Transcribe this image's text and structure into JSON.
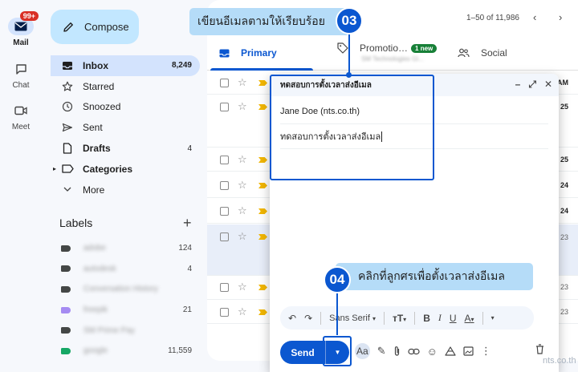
{
  "rail": {
    "mail_label": "Mail",
    "mail_badge": "99+",
    "chat_label": "Chat",
    "meet_label": "Meet"
  },
  "sidebar": {
    "compose_label": "Compose",
    "items": [
      {
        "label": "Inbox",
        "count": "8,249"
      },
      {
        "label": "Starred",
        "count": ""
      },
      {
        "label": "Snoozed",
        "count": ""
      },
      {
        "label": "Sent",
        "count": ""
      },
      {
        "label": "Drafts",
        "count": "4"
      },
      {
        "label": "Categories",
        "count": ""
      },
      {
        "label": "More",
        "count": ""
      }
    ],
    "labels_heading": "Labels",
    "labels": [
      {
        "name": "adobe",
        "count": "124",
        "color": "#444746"
      },
      {
        "name": "autodesk",
        "count": "4",
        "color": "#444746"
      },
      {
        "name": "Conversation History",
        "count": "",
        "color": "#444746"
      },
      {
        "name": "freepik",
        "count": "21",
        "color": "#a58bf2"
      },
      {
        "name": "SM Prime Pay",
        "count": "",
        "color": "#444746"
      },
      {
        "name": "google",
        "count": "11,559",
        "color": "#16a765"
      }
    ]
  },
  "header": {
    "pagination": "1–50 of 11,986"
  },
  "tabs": {
    "primary": "Primary",
    "promotions": "Promotio…",
    "promotions_badge": "1 new",
    "promotions_sub": "SM Technologies Gl...",
    "social": "Social"
  },
  "rows": [
    {
      "date": "AM",
      "bold": true
    },
    {
      "date": "25",
      "bold": true
    },
    {
      "date": "25",
      "bold": true
    },
    {
      "date": "24",
      "bold": true
    },
    {
      "date": "24",
      "bold": true
    },
    {
      "date": "23",
      "bold": false
    },
    {
      "date": "23",
      "bold": false
    },
    {
      "date": "23",
      "bold": false
    }
  ],
  "compose": {
    "title": "ทดสอบการตั้งเวลาส่งอีเมล",
    "to": "Jane Doe (nts.co.th)",
    "subject": "ทดสอบการตั้งเวลาส่งอีเมล",
    "font_name": "Sans Serif",
    "send_label": "Send"
  },
  "annotations": {
    "step1_number": "03",
    "step1_text": "เขียนอีเมลตามให้เรียบร้อย",
    "step2_number": "04",
    "step2_text": "คลิกที่ลูกศรเพื่อตั้งเวลาส่งอีเมล",
    "accent_color": "#0b57d0",
    "callout_color": "#b5dcf8"
  },
  "watermark": "nts.co.th"
}
